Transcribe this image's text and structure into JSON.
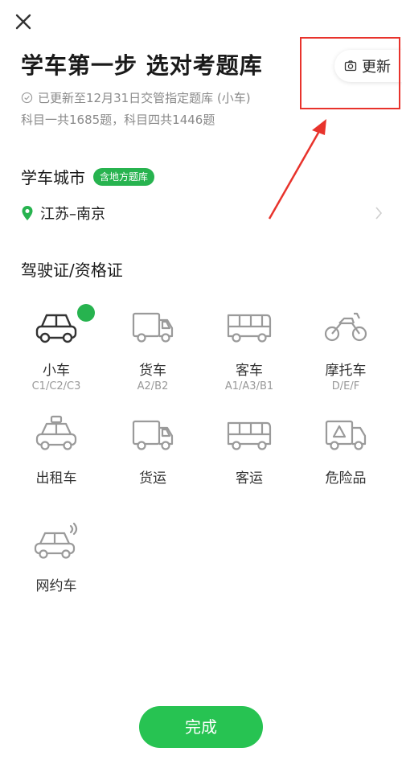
{
  "header": {
    "close_icon": "close-icon",
    "title": "学车第一步 选对考题库",
    "update_info": "已更新至12月31日交管指定题库 (小车)",
    "count_info": "科目一共1685题，科目四共1446题",
    "update_button_label": "更新"
  },
  "city": {
    "section_title": "学车城市",
    "badge": "含地方题库",
    "value": "江苏–南京"
  },
  "license": {
    "section_title": "驾驶证/资格证",
    "items": [
      {
        "label": "小车",
        "sub": "C1/C2/C3",
        "icon": "car-icon",
        "selected": true
      },
      {
        "label": "货车",
        "sub": "A2/B2",
        "icon": "truck-icon",
        "selected": false
      },
      {
        "label": "客车",
        "sub": "A1/A3/B1",
        "icon": "bus-icon",
        "selected": false
      },
      {
        "label": "摩托车",
        "sub": "D/E/F",
        "icon": "motorcycle-icon",
        "selected": false
      },
      {
        "label": "出租车",
        "sub": "",
        "icon": "taxi-icon",
        "selected": false
      },
      {
        "label": "货运",
        "sub": "",
        "icon": "truck-icon",
        "selected": false
      },
      {
        "label": "客运",
        "sub": "",
        "icon": "bus-icon",
        "selected": false
      },
      {
        "label": "危险品",
        "sub": "",
        "icon": "hazmat-truck-icon",
        "selected": false
      },
      {
        "label": "网约车",
        "sub": "",
        "icon": "ride-hailing-car-icon",
        "selected": false
      }
    ]
  },
  "footer": {
    "done_label": "完成"
  },
  "colors": {
    "accent": "#27c352",
    "annotation": "#e8332c",
    "icon_selected": "#333333",
    "icon_default": "#9a9a9a"
  }
}
